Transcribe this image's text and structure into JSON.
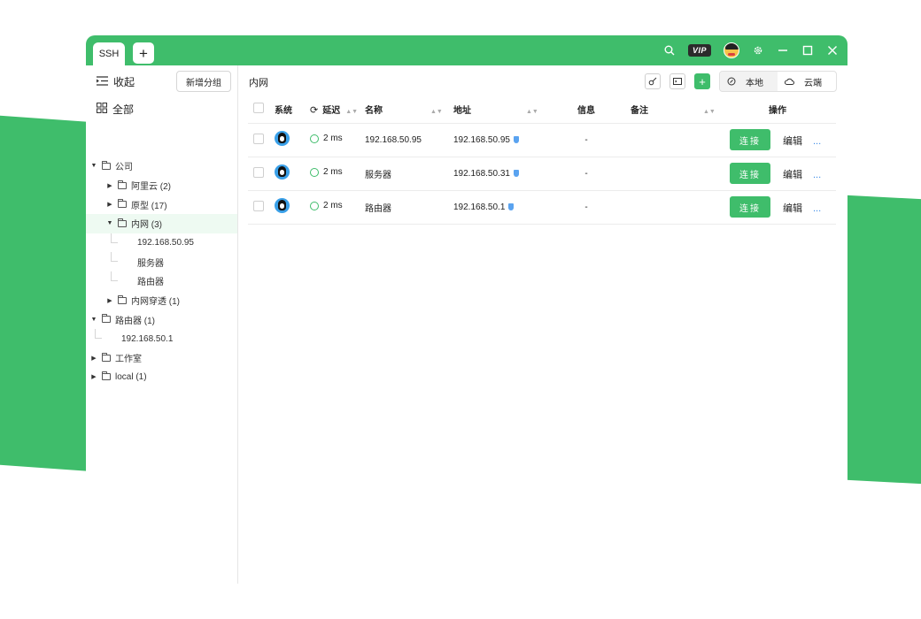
{
  "window": {
    "tabs": [
      {
        "label": "SSH"
      }
    ],
    "add_tab": "+",
    "vip": "VIP"
  },
  "sidebar": {
    "collapse_label": "收起",
    "new_group_label": "新增分组",
    "all_label": "全部",
    "tree": [
      {
        "label": "公司",
        "caret": "▼",
        "level": 0,
        "type": "folder"
      },
      {
        "label": "阿里云 (2)",
        "caret": "▶",
        "level": 1,
        "type": "folder"
      },
      {
        "label": "原型 (17)",
        "caret": "▶",
        "level": 1,
        "type": "folder"
      },
      {
        "label": "内网 (3)",
        "caret": "▼",
        "level": 1,
        "type": "folder",
        "active": true
      },
      {
        "label": "192.168.50.95",
        "level": 2,
        "type": "leaf"
      },
      {
        "label": "服务器",
        "level": 2,
        "type": "leaf"
      },
      {
        "label": "路由器",
        "level": 2,
        "type": "leaf"
      },
      {
        "label": "内网穿透 (1)",
        "caret": "▶",
        "level": 1,
        "type": "folder"
      },
      {
        "label": "路由器 (1)",
        "caret": "▼",
        "level": 0,
        "type": "folder"
      },
      {
        "label": "192.168.50.1",
        "level": 1,
        "type": "leaf"
      },
      {
        "label": "工作室",
        "caret": "▶",
        "level": 0,
        "type": "folder"
      },
      {
        "label": "local (1)",
        "caret": "▶",
        "level": 0,
        "type": "folder"
      }
    ]
  },
  "main": {
    "breadcrumb": "内网",
    "local_label": "本地",
    "cloud_label": "云端",
    "columns": {
      "system": "系统",
      "latency": "延迟",
      "name": "名称",
      "address": "地址",
      "info": "信息",
      "note": "备注",
      "actions": "操作"
    },
    "rows": [
      {
        "latency": "2 ms",
        "name": "192.168.50.95",
        "address": "192.168.50.95",
        "info": "-",
        "note": ""
      },
      {
        "latency": "2 ms",
        "name": "服务器",
        "address": "192.168.50.31",
        "info": "-",
        "note": ""
      },
      {
        "latency": "2 ms",
        "name": "路由器",
        "address": "192.168.50.1",
        "info": "-",
        "note": ""
      }
    ],
    "connect_label": "连接",
    "edit_label": "编辑",
    "more_label": "..."
  },
  "colors": {
    "accent": "#3fbd6b",
    "link": "#3c8ce7"
  }
}
